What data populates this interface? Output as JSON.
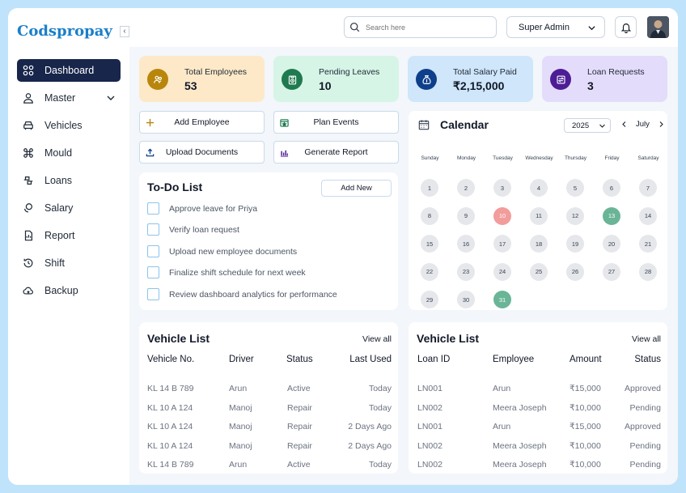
{
  "sidebar": {
    "logo": "Codspropay",
    "items": [
      {
        "label": "Dashboard"
      },
      {
        "label": "Master"
      },
      {
        "label": "Vehicles"
      },
      {
        "label": "Mould"
      },
      {
        "label": "Loans"
      },
      {
        "label": "Salary"
      },
      {
        "label": "Report"
      },
      {
        "label": "Shift"
      },
      {
        "label": "Backup"
      }
    ]
  },
  "topbar": {
    "search_placeholder": "Search here",
    "role": "Super Admin"
  },
  "stats": [
    {
      "label": "Total Employees",
      "value": "53"
    },
    {
      "label": "Pending Leaves",
      "value": "10"
    },
    {
      "label": "Total Salary Paid",
      "value": "₹2,15,000"
    },
    {
      "label": "Loan Requests",
      "value": "3"
    }
  ],
  "actions": {
    "add_employee": "Add Employee",
    "plan_events": "Plan Events",
    "upload_documents": "Upload Documents",
    "generate_report": "Generate Report"
  },
  "todo": {
    "title": "To-Do List",
    "add_new": "Add New",
    "items": [
      "Approve leave for Priya",
      "Verify loan request",
      "Upload new employee documents",
      "Finalize shift schedule for next week",
      "Review dashboard analytics for performance"
    ]
  },
  "calendar": {
    "title": "Calendar",
    "year": "2025",
    "month": "July",
    "weekdays": [
      "Sunday",
      "Monday",
      "Tuesday",
      "Wednesday",
      "Thursday",
      "Friday",
      "Saturday"
    ],
    "days": [
      [
        "1",
        "2",
        "3",
        "4",
        "5",
        "6",
        "7"
      ],
      [
        "8",
        "9",
        "10",
        "11",
        "12",
        "13",
        "14"
      ],
      [
        "15",
        "16",
        "17",
        "18",
        "19",
        "20",
        "21"
      ],
      [
        "22",
        "23",
        "24",
        "25",
        "26",
        "27",
        "28"
      ],
      [
        "29",
        "30",
        "31"
      ]
    ],
    "highlight_red": "10",
    "highlight_green": [
      "13",
      "31"
    ]
  },
  "vehicle_list": {
    "title": "Vehicle List",
    "view_all": "View all",
    "headers": [
      "Vehicle No.",
      "Driver",
      "Status",
      "Last Used"
    ],
    "rows": [
      [
        "KL 14 B 789",
        "Arun",
        "Active",
        "Today"
      ],
      [
        "KL 10 A 124",
        "Manoj",
        "Repair",
        "Today"
      ],
      [
        "KL 10 A 124",
        "Manoj",
        "Repair",
        "2 Days Ago"
      ],
      [
        "KL 10 A 124",
        "Manoj",
        "Repair",
        "2 Days Ago"
      ],
      [
        "KL 14 B 789",
        "Arun",
        "Active",
        "Today"
      ]
    ]
  },
  "loan_list": {
    "title": "Vehicle List",
    "view_all": "View all",
    "headers": [
      "Loan ID",
      "Employee",
      "Amount",
      "Status"
    ],
    "rows": [
      [
        "LN001",
        "Arun",
        "₹15,000",
        "Approved"
      ],
      [
        "LN002",
        "Meera Joseph",
        "₹10,000",
        "Pending"
      ],
      [
        "LN001",
        "Arun",
        "₹15,000",
        "Approved"
      ],
      [
        "LN002",
        "Meera Joseph",
        "₹10,000",
        "Pending"
      ],
      [
        "LN002",
        "Meera Joseph",
        "₹10,000",
        "Pending"
      ]
    ]
  },
  "colors": {
    "accent": "#17264a",
    "brand": "#1a7fc9",
    "stat_bg": [
      "#fde9c8",
      "#d6f5e6",
      "#cfe6fb",
      "#e4dcfb"
    ],
    "stat_icon": [
      "#b8860b",
      "#1f7a4f",
      "#0e3f8a",
      "#4c1d95"
    ]
  }
}
